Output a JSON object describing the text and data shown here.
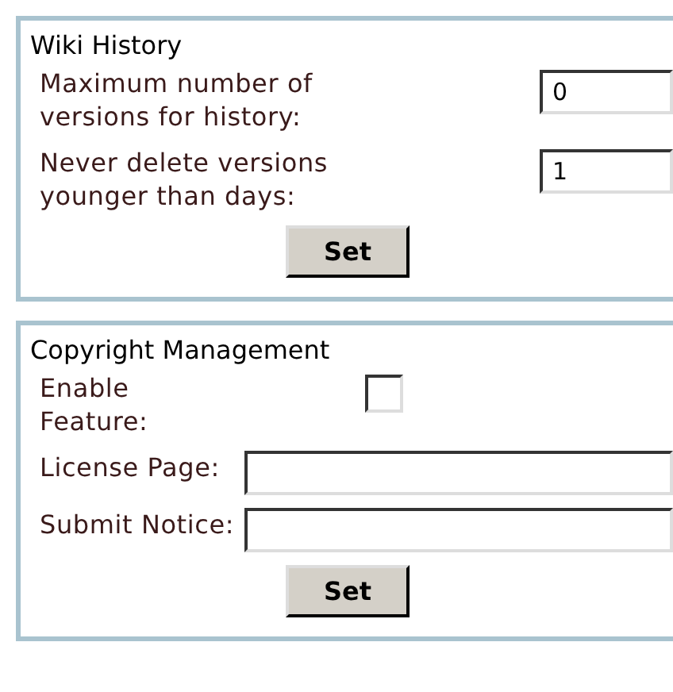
{
  "panels": [
    {
      "title": "Wiki History",
      "fields": [
        {
          "kind": "number",
          "label": "Maximum number of versions for history:",
          "value": "0"
        },
        {
          "kind": "number",
          "label": "Never delete versions younger than days:",
          "value": "1"
        }
      ],
      "button": "Set"
    },
    {
      "title": "Copyright Management",
      "fields": [
        {
          "kind": "checkbox",
          "label": "Enable Feature:",
          "checked": false
        },
        {
          "kind": "text",
          "label": "License Page:"
        },
        {
          "kind": "text",
          "label": "Submit Notice:"
        }
      ],
      "button": "Set"
    }
  ]
}
